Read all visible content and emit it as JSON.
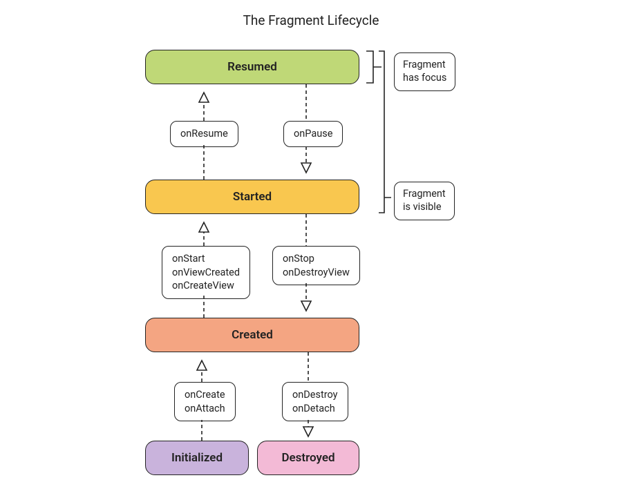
{
  "title": "The Fragment Lifecycle",
  "states": {
    "resumed": {
      "label": "Resumed",
      "color": "#BFD877"
    },
    "started": {
      "label": "Started",
      "color": "#F9C74F"
    },
    "created": {
      "label": "Created",
      "color": "#F4A582"
    },
    "initialized": {
      "label": "Initialized",
      "color": "#C9B3DC"
    },
    "destroyed": {
      "label": "Destroyed",
      "color": "#F3BAD6"
    }
  },
  "transitions": {
    "onResume": {
      "lines": [
        "onResume"
      ]
    },
    "onPause": {
      "lines": [
        "onPause"
      ]
    },
    "startUp": {
      "lines": [
        "onStart",
        "onViewCreated",
        "onCreateView"
      ]
    },
    "stopDown": {
      "lines": [
        "onStop",
        "onDestroyView"
      ]
    },
    "createUp": {
      "lines": [
        "onCreate",
        "onAttach"
      ]
    },
    "destroyDn": {
      "lines": [
        "onDestroy",
        "onDetach"
      ]
    }
  },
  "notes": {
    "focus": {
      "lines": [
        "Fragment",
        "has focus"
      ]
    },
    "visible": {
      "lines": [
        "Fragment",
        "is visible"
      ]
    }
  }
}
